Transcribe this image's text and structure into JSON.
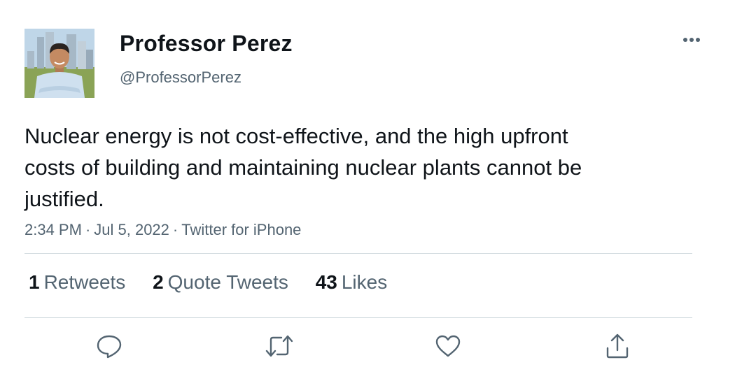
{
  "author": {
    "display_name": "Professor Perez",
    "handle": "@ProfessorPerez"
  },
  "tweet": {
    "text": "Nuclear energy is not cost-effective, and the high upfront costs of building and maintaining nuclear plants cannot be justified.",
    "time": "2:34 PM",
    "date": "Jul 5, 2022",
    "source": "Twitter for iPhone",
    "separator": "·"
  },
  "stats": {
    "retweets": {
      "count": "1",
      "label": "Retweets"
    },
    "quotes": {
      "count": "2",
      "label": "Quote Tweets"
    },
    "likes": {
      "count": "43",
      "label": "Likes"
    }
  },
  "icons": {
    "more": "more-horizontal-icon",
    "reply": "reply-icon",
    "retweet": "retweet-icon",
    "like": "heart-icon",
    "share": "share-icon"
  },
  "colors": {
    "text_primary": "#0f1419",
    "text_secondary": "#536471",
    "divider": "#cfd9de",
    "icon": "#536471"
  }
}
